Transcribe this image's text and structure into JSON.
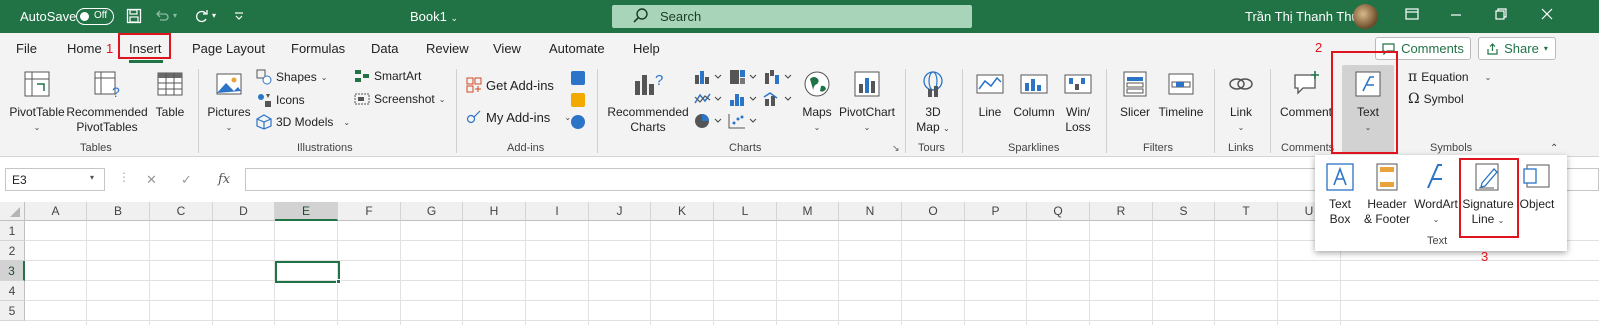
{
  "titlebar": {
    "autosave_label": "AutoSave",
    "autosave_state": "Off",
    "book_name": "Book1",
    "search_placeholder": "Search",
    "user_name": "Trần Thị Thanh Thư"
  },
  "menu": {
    "tabs": [
      "File",
      "Home",
      "Insert",
      "Page Layout",
      "Formulas",
      "Data",
      "Review",
      "View",
      "Automate",
      "Help"
    ],
    "active_tab": "Insert",
    "comments_label": "Comments",
    "share_label": "Share"
  },
  "annotations": {
    "step1": "1",
    "step2": "2",
    "step3": "3",
    "color": "#e0141e"
  },
  "ribbon": {
    "pivottable": "PivotTable",
    "recommended_pivottables_1": "Recommended",
    "recommended_pivottables_2": "PivotTables",
    "table": "Table",
    "group_tables": "Tables",
    "pictures": "Pictures",
    "shapes": "Shapes",
    "icons": "Icons",
    "models3d": "3D Models",
    "smartart": "SmartArt",
    "screenshot": "Screenshot",
    "group_illustrations": "Illustrations",
    "get_addins": "Get Add-ins",
    "my_addins": "My Add-ins",
    "group_addins": "Add-ins",
    "recommended_charts_1": "Recommended",
    "recommended_charts_2": "Charts",
    "maps": "Maps",
    "pivotchart": "PivotChart",
    "group_charts": "Charts",
    "map3d_1": "3D",
    "map3d_2": "Map",
    "group_tours": "Tours",
    "line": "Line",
    "column": "Column",
    "winloss_1": "Win/",
    "winloss_2": "Loss",
    "group_sparklines": "Sparklines",
    "slicer": "Slicer",
    "timeline": "Timeline",
    "group_filters": "Filters",
    "link": "Link",
    "group_links": "Links",
    "comment": "Comment",
    "group_comments": "Comments",
    "text": "Text",
    "equation": "Equation",
    "symbol": "Symbol",
    "group_symbols": "Symbols"
  },
  "formula_bar": {
    "name_box": "E3",
    "fx": "fx",
    "value": ""
  },
  "grid": {
    "columns": [
      "A",
      "B",
      "C",
      "D",
      "E",
      "F",
      "G",
      "H",
      "I",
      "J",
      "K",
      "L",
      "M",
      "N",
      "O",
      "P",
      "Q",
      "R",
      "S",
      "T",
      "U"
    ],
    "rows": [
      "1",
      "2",
      "3",
      "4",
      "5"
    ],
    "selected_column": "E",
    "selected_row": "3"
  },
  "text_panel": {
    "textbox_1": "Text",
    "textbox_2": "Box",
    "header_1": "Header",
    "header_2": "& Footer",
    "wordart": "WordArt",
    "signature_1": "Signature",
    "signature_2": "Line",
    "object": "Object",
    "group_label": "Text"
  },
  "colors": {
    "brand_green": "#217346",
    "search_bg": "#a8d5b9",
    "ribbon_bg": "#f3f3f3"
  }
}
